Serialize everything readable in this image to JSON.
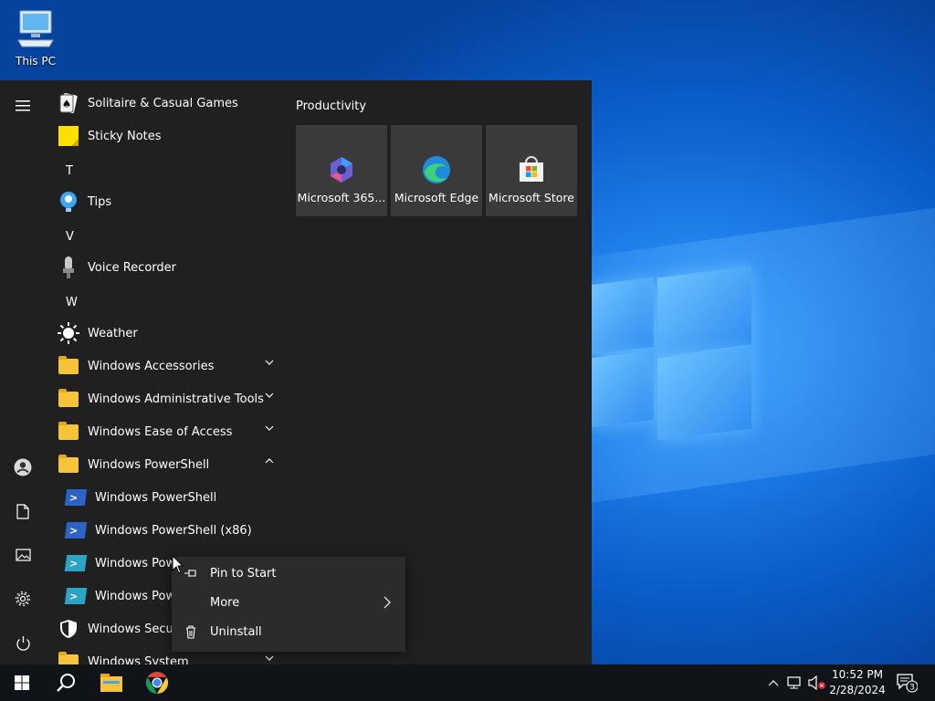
{
  "desktop": {
    "icons": [
      {
        "label": "This PC",
        "icon": "computer-icon"
      }
    ]
  },
  "start_menu": {
    "rail": [
      "hamburger-menu-icon",
      "user-account-icon",
      "documents-icon",
      "pictures-icon",
      "settings-icon",
      "power-icon"
    ],
    "apps": [
      {
        "label": "Solitaire & Casual Games",
        "icon": "solitaire-icon"
      },
      {
        "label": "Sticky Notes",
        "icon": "sticky-notes-icon"
      },
      {
        "letter": "T"
      },
      {
        "label": "Tips",
        "icon": "tips-icon"
      },
      {
        "letter": "V"
      },
      {
        "label": "Voice Recorder",
        "icon": "microphone-icon"
      },
      {
        "letter": "W"
      },
      {
        "label": "Weather",
        "icon": "weather-sun-icon"
      },
      {
        "label": "Windows Accessories",
        "icon": "folder-icon",
        "expanded": false
      },
      {
        "label": "Windows Administrative Tools",
        "icon": "folder-icon",
        "expanded": false
      },
      {
        "label": "Windows Ease of Access",
        "icon": "folder-icon",
        "expanded": false
      },
      {
        "label": "Windows PowerShell",
        "icon": "folder-icon",
        "expanded": true
      },
      {
        "label": "Windows PowerShell",
        "icon": "powershell-icon"
      },
      {
        "label": "Windows PowerShell (x86)",
        "icon": "powershell-icon"
      },
      {
        "label": "Windows Powe",
        "icon": "powershell-ise-icon"
      },
      {
        "label": "Windows Powe",
        "icon": "powershell-ise-icon"
      },
      {
        "label": "Windows Securit",
        "icon": "shield-icon"
      },
      {
        "label": "Windows System",
        "icon": "folder-icon",
        "expanded": false
      }
    ],
    "tiles_group": "Productivity",
    "tiles": [
      {
        "label": "Microsoft 365...",
        "icon": "microsoft-365-icon"
      },
      {
        "label": "Microsoft Edge",
        "icon": "edge-icon"
      },
      {
        "label": "Microsoft Store",
        "icon": "store-icon"
      }
    ]
  },
  "context_menu": {
    "items": [
      {
        "label": "Pin to Start",
        "icon": "pin-icon"
      },
      {
        "label": "More",
        "icon": "",
        "submenu": true
      },
      {
        "label": "Uninstall",
        "icon": "trash-icon"
      }
    ]
  },
  "taskbar": {
    "buttons": [
      "windows-start-icon",
      "search-icon",
      "file-explorer-icon",
      "chrome-icon"
    ],
    "tray": {
      "icons": [
        "chevron-up-icon",
        "network-icon",
        "volume-muted-icon"
      ],
      "time": "10:52 PM",
      "date": "2/28/2024",
      "notification_count": "3"
    }
  },
  "colors": {
    "accent": "#0078d4",
    "menu_bg": "#202020",
    "tile_bg": "#3a3a3a",
    "taskbar_bg": "#101418"
  }
}
